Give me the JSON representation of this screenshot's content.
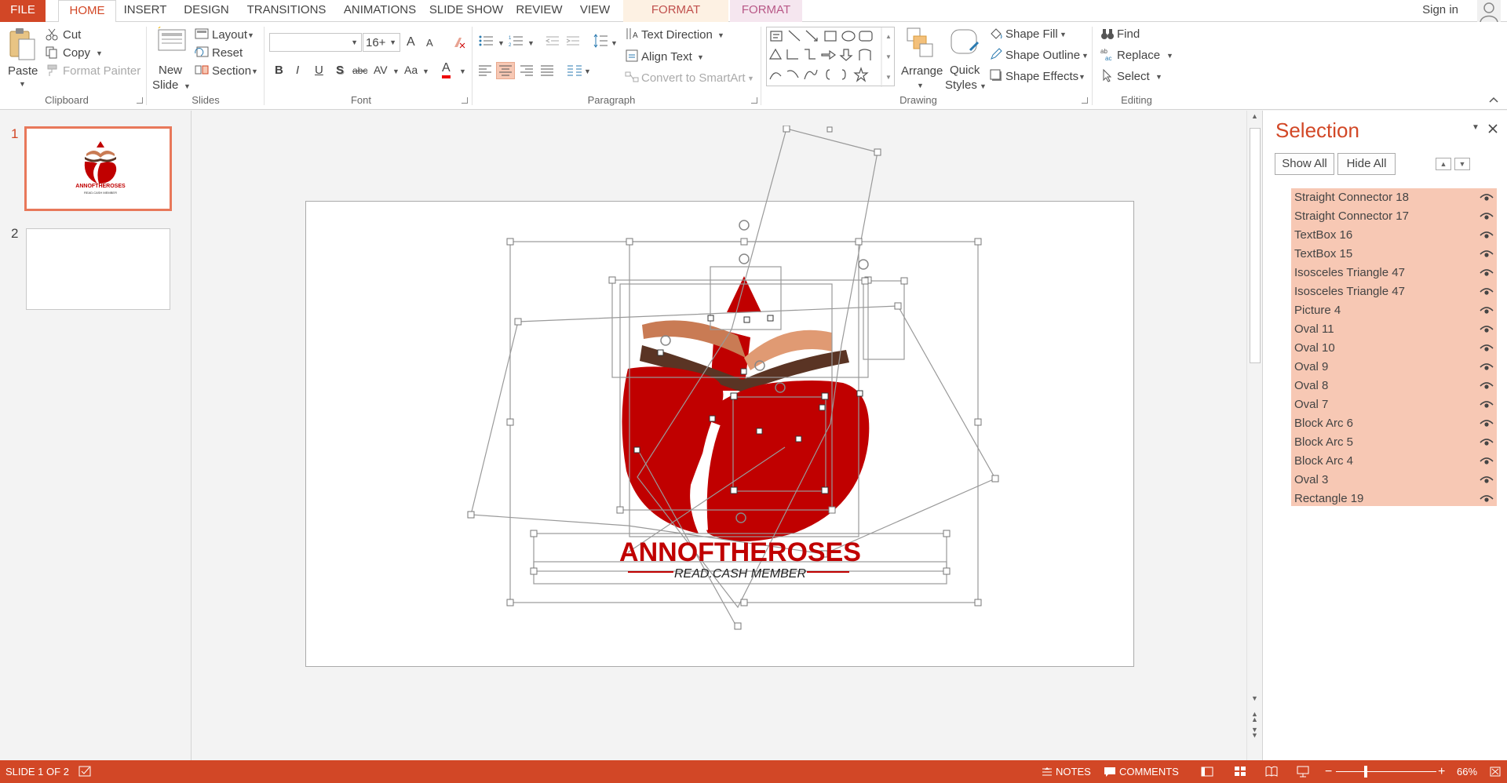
{
  "tabs": {
    "file": "FILE",
    "home": "HOME",
    "insert": "INSERT",
    "design": "DESIGN",
    "transitions": "TRANSITIONS",
    "animations": "ANIMATIONS",
    "slideshow": "SLIDE SHOW",
    "review": "REVIEW",
    "view": "VIEW",
    "format1": "FORMAT",
    "format2": "FORMAT"
  },
  "signin": "Sign in",
  "clipboard": {
    "paste": "Paste",
    "cut": "Cut",
    "copy": "Copy",
    "format_painter": "Format Painter",
    "label": "Clipboard"
  },
  "slides_group": {
    "new_slide_1": "New",
    "new_slide_2": "Slide",
    "layout": "Layout",
    "reset": "Reset",
    "section": "Section",
    "label": "Slides"
  },
  "font": {
    "name_value": "",
    "size_value": "16+",
    "grow": "A",
    "shrink": "A",
    "bold": "B",
    "italic": "I",
    "underline": "U",
    "shadow": "S",
    "strike": "abc",
    "spacing": "AV",
    "case": "Aa",
    "color": "A",
    "label": "Font"
  },
  "paragraph": {
    "text_direction": "Text Direction",
    "align_text": "Align Text",
    "convert_smartart": "Convert to SmartArt",
    "label": "Paragraph"
  },
  "drawing": {
    "arrange": "Arrange",
    "quick_styles_1": "Quick",
    "quick_styles_2": "Styles",
    "shape_fill": "Shape Fill",
    "shape_outline": "Shape Outline",
    "shape_effects": "Shape Effects",
    "label": "Drawing"
  },
  "editing": {
    "find": "Find",
    "replace": "Replace",
    "select": "Select",
    "label": "Editing"
  },
  "thumbnails": {
    "slide1_num": "1",
    "slide2_num": "2",
    "logo_title": "ANNOFTHEROSES",
    "logo_sub": "READ.CASH MEMBER"
  },
  "slide": {
    "logo_title": "ANNOFTHEROSES",
    "logo_subtitle": "READ.CASH MEMBER"
  },
  "selection_pane": {
    "title": "Selection",
    "show_all": "Show All",
    "hide_all": "Hide All",
    "items": [
      "Straight Connector 18",
      "Straight Connector 17",
      "TextBox 16",
      "TextBox 15",
      "Isosceles Triangle 47",
      "Isosceles Triangle 47",
      "Picture 4",
      "Oval 11",
      "Oval 10",
      "Oval 9",
      "Oval 8",
      "Oval 7",
      "Block Arc 6",
      "Block Arc 5",
      "Block Arc 4",
      "Oval 3",
      "Rectangle 19"
    ]
  },
  "status": {
    "slide_info": "SLIDE 1 OF 2",
    "notes": "NOTES",
    "comments": "COMMENTS",
    "zoom": "66%"
  },
  "colors": {
    "accent": "#d24726",
    "selection_highlight": "#f7c8b4",
    "logo_red": "#c00000",
    "logo_dark": "#5a3424",
    "logo_mid": "#c97b54",
    "logo_light": "#e09a73"
  }
}
